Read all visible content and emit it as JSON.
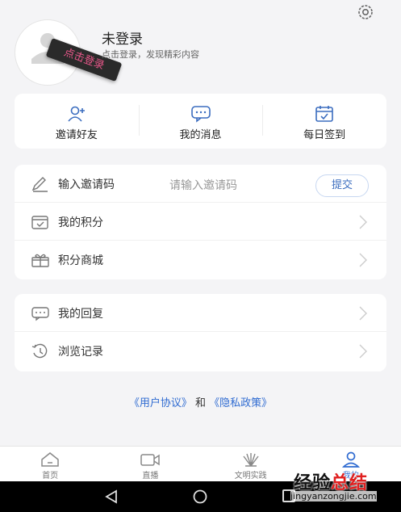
{
  "profile": {
    "username": "未登录",
    "subtitle": "点击登录，发现精彩内容",
    "login_tag": "点击登录"
  },
  "quick_actions": [
    {
      "label": "邀请好友",
      "icon": "add-user-icon"
    },
    {
      "label": "我的消息",
      "icon": "message-icon"
    },
    {
      "label": "每日签到",
      "icon": "calendar-check-icon"
    }
  ],
  "menu1": {
    "invite": {
      "label": "输入邀请码",
      "placeholder": "请输入邀请码",
      "submit": "提交"
    },
    "points": {
      "label": "我的积分"
    },
    "mall": {
      "label": "积分商城"
    }
  },
  "menu2": {
    "replies": {
      "label": "我的回复"
    },
    "history": {
      "label": "浏览记录"
    }
  },
  "policy": {
    "agreement": "《用户协议》",
    "and": "和",
    "privacy": "《隐私政策》"
  },
  "tabs": [
    {
      "label": "首页"
    },
    {
      "label": "直播"
    },
    {
      "label": "文明实践"
    },
    {
      "label": "我的"
    }
  ],
  "watermark": {
    "title_a": "经验",
    "title_b": "总结",
    "url": "jingyanzongjie.com"
  },
  "colors": {
    "accent": "#2f6bd1",
    "tag_bg": "#2a2a2a",
    "tag_text": "#e8578a"
  }
}
